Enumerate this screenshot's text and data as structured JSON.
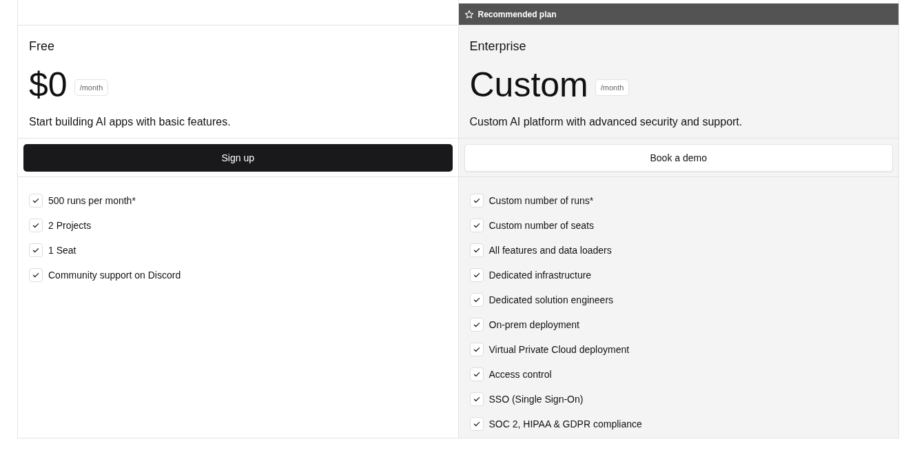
{
  "plans": [
    {
      "name": "Free",
      "price": "$0",
      "period": "/month",
      "description": "Start building AI apps with basic features.",
      "recommended": false,
      "button": {
        "label": "Sign up",
        "kind": "primary"
      },
      "features": [
        "500 runs per month*",
        "2 Projects",
        "1 Seat",
        "Community support on Discord"
      ]
    },
    {
      "name": "Enterprise",
      "price": "Custom",
      "period": "/month",
      "description": "Custom AI platform with advanced security and support.",
      "recommended": true,
      "badge": "Recommended plan",
      "button": {
        "label": "Book a demo",
        "kind": "secondary"
      },
      "features": [
        "Custom number of runs*",
        "Custom number of seats",
        "All features and data loaders",
        "Dedicated infrastructure",
        "Dedicated solution engineers",
        "On-prem deployment",
        "Virtual Private Cloud deployment",
        "Access control",
        "SSO (Single Sign-On)",
        "SOC 2, HIPAA & GDPR compliance"
      ]
    }
  ]
}
